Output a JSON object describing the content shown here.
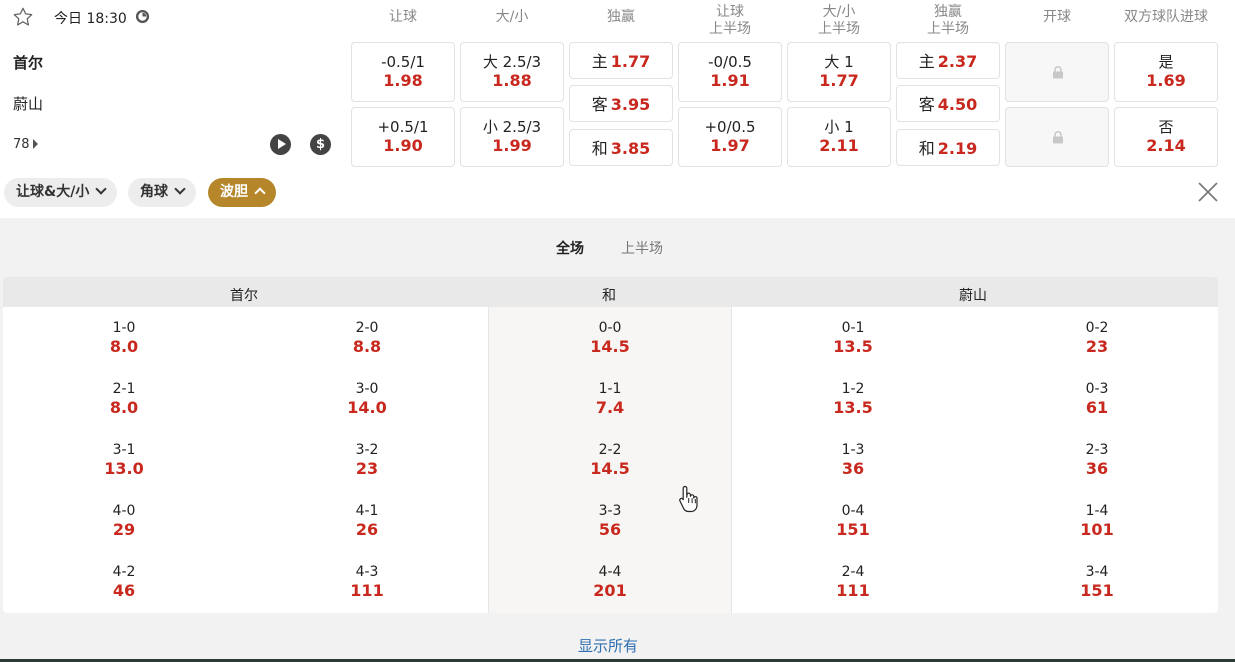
{
  "match": {
    "time_label": "今日 18:30",
    "home_team": "首尔",
    "away_team": "蔚山",
    "markets_count": "78"
  },
  "columns": [
    {
      "line1": "让球",
      "line2": ""
    },
    {
      "line1": "大/小",
      "line2": ""
    },
    {
      "line1": "独赢",
      "line2": ""
    },
    {
      "line1": "让球",
      "line2": "上半场"
    },
    {
      "line1": "大/小",
      "line2": "上半场"
    },
    {
      "line1": "独赢",
      "line2": "上半场"
    },
    {
      "line1": "开球",
      "line2": ""
    },
    {
      "line1": "双方球队进球",
      "line2": ""
    }
  ],
  "odds": {
    "handicap": [
      {
        "label": "-0.5/1",
        "odd": "1.98"
      },
      {
        "label": "+0.5/1",
        "odd": "1.90"
      }
    ],
    "over_under": [
      {
        "label": "大 2.5/3",
        "odd": "1.88"
      },
      {
        "label": "小 2.5/3",
        "odd": "1.99"
      }
    ],
    "moneyline": [
      {
        "label": "主",
        "odd": "1.77"
      },
      {
        "label": "客",
        "odd": "3.95"
      },
      {
        "label": "和",
        "odd": "3.85"
      }
    ],
    "handicap_1h": [
      {
        "label": "-0/0.5",
        "odd": "1.91"
      },
      {
        "label": "+0/0.5",
        "odd": "1.97"
      }
    ],
    "over_under_1h": [
      {
        "label": "大 1",
        "odd": "1.77"
      },
      {
        "label": "小 1",
        "odd": "2.11"
      }
    ],
    "moneyline_1h": [
      {
        "label": "主",
        "odd": "2.37"
      },
      {
        "label": "客",
        "odd": "4.50"
      },
      {
        "label": "和",
        "odd": "2.19"
      }
    ],
    "kickoff": [
      "locked",
      "locked"
    ],
    "both_score": [
      {
        "label": "是",
        "odd": "1.69"
      },
      {
        "label": "否",
        "odd": "2.14"
      }
    ]
  },
  "filters": [
    {
      "label": "让球&大/小",
      "active": false
    },
    {
      "label": "角球",
      "active": false
    },
    {
      "label": "波胆",
      "active": true
    }
  ],
  "correct_score": {
    "tabs": [
      "全场",
      "上半场"
    ],
    "headers": {
      "home": "首尔",
      "draw": "和",
      "away": "蔚山"
    },
    "home_col1": [
      {
        "score": "1-0",
        "odd": "8.0"
      },
      {
        "score": "2-1",
        "odd": "8.0"
      },
      {
        "score": "3-1",
        "odd": "13.0"
      },
      {
        "score": "4-0",
        "odd": "29"
      },
      {
        "score": "4-2",
        "odd": "46"
      }
    ],
    "home_col2": [
      {
        "score": "2-0",
        "odd": "8.8"
      },
      {
        "score": "3-0",
        "odd": "14.0"
      },
      {
        "score": "3-2",
        "odd": "23"
      },
      {
        "score": "4-1",
        "odd": "26"
      },
      {
        "score": "4-3",
        "odd": "111"
      }
    ],
    "draw_col": [
      {
        "score": "0-0",
        "odd": "14.5"
      },
      {
        "score": "1-1",
        "odd": "7.4"
      },
      {
        "score": "2-2",
        "odd": "14.5"
      },
      {
        "score": "3-3",
        "odd": "56"
      },
      {
        "score": "4-4",
        "odd": "201"
      }
    ],
    "away_col1": [
      {
        "score": "0-1",
        "odd": "13.5"
      },
      {
        "score": "1-2",
        "odd": "13.5"
      },
      {
        "score": "1-3",
        "odd": "36"
      },
      {
        "score": "0-4",
        "odd": "151"
      },
      {
        "score": "2-4",
        "odd": "111"
      }
    ],
    "away_col2": [
      {
        "score": "0-2",
        "odd": "23"
      },
      {
        "score": "0-3",
        "odd": "61"
      },
      {
        "score": "2-3",
        "odd": "36"
      },
      {
        "score": "1-4",
        "odd": "101"
      },
      {
        "score": "3-4",
        "odd": "151"
      }
    ],
    "show_all_label": "显示所有"
  },
  "colors": {
    "odd": "#c8281e",
    "accent": "#b5862a",
    "link": "#2f6fb0"
  },
  "icons": [
    "star-icon",
    "clock-icon",
    "play-icon",
    "dollar-icon",
    "lock-icon",
    "chevron-down-icon",
    "chevron-up-icon",
    "close-icon",
    "hand-cursor-icon"
  ]
}
